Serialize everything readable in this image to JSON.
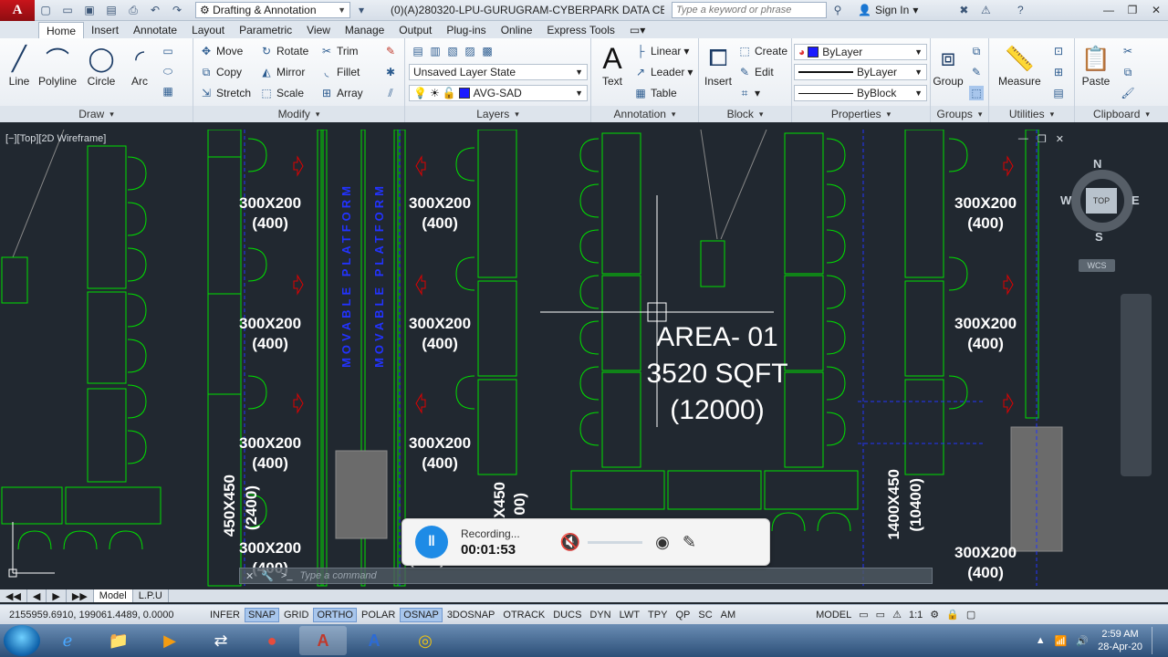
{
  "titlebar": {
    "workspace": "Drafting & Annotation",
    "document_title": "(0)(A)280320-LPU-GURUGRAM-CYBERPARK DATA CENTE...",
    "search_placeholder": "Type a keyword or phrase",
    "signin_label": "Sign In"
  },
  "tabs": [
    "Home",
    "Insert",
    "Annotate",
    "Layout",
    "Parametric",
    "View",
    "Manage",
    "Output",
    "Plug-ins",
    "Online",
    "Express Tools"
  ],
  "ribbon": {
    "draw": {
      "title": "Draw",
      "line": "Line",
      "polyline": "Polyline",
      "circle": "Circle",
      "arc": "Arc"
    },
    "modify": {
      "title": "Modify",
      "move": "Move",
      "rotate": "Rotate",
      "trim": "Trim",
      "copy": "Copy",
      "mirror": "Mirror",
      "fillet": "Fillet",
      "stretch": "Stretch",
      "scale": "Scale",
      "array": "Array"
    },
    "layers": {
      "title": "Layers",
      "layer_state": "Unsaved Layer State",
      "current_layer": "AVG-SAD"
    },
    "annotation": {
      "title": "Annotation",
      "text": "Text",
      "linear": "Linear",
      "leader": "Leader",
      "table": "Table"
    },
    "block": {
      "title": "Block",
      "insert": "Insert",
      "create": "Create",
      "edit": "Edit"
    },
    "properties": {
      "title": "Properties",
      "color": "ByLayer",
      "linetype": "ByLayer",
      "lineweight": "ByBlock"
    },
    "groups": {
      "title": "Groups",
      "group": "Group"
    },
    "utilities": {
      "title": "Utilities",
      "measure": "Measure"
    },
    "clipboard": {
      "title": "Clipboard",
      "paste": "Paste"
    }
  },
  "viewport": {
    "label": "[−][Top][2D Wireframe]",
    "area_name": "AREA- 01",
    "area_size": "3520 SQFT",
    "area_code": "(12000)",
    "duct_size": "300X200",
    "duct_flow": "(400)",
    "platform_text": "MOVABLE PLATFORM",
    "vertical_labels": [
      "450X450",
      "(2400)",
      "1400X450",
      "(10400)",
      "X450",
      "00)"
    ],
    "viewcube": {
      "n": "N",
      "s": "S",
      "e": "E",
      "w": "W",
      "top": "TOP",
      "wcs": "WCS"
    }
  },
  "command_line": {
    "placeholder": "Type a command"
  },
  "recorder": {
    "status": "Recording...",
    "time": "00:01:53"
  },
  "layout_tabs": [
    "Model",
    "L.P.U"
  ],
  "statusbar": {
    "coords": "2155959.6910, 199061.4489, 0.0000",
    "toggles": [
      {
        "label": "INFER",
        "on": false
      },
      {
        "label": "SNAP",
        "on": true
      },
      {
        "label": "GRID",
        "on": false
      },
      {
        "label": "ORTHO",
        "on": true
      },
      {
        "label": "POLAR",
        "on": false
      },
      {
        "label": "OSNAP",
        "on": true
      },
      {
        "label": "3DOSNAP",
        "on": false
      },
      {
        "label": "OTRACK",
        "on": false
      },
      {
        "label": "DUCS",
        "on": false
      },
      {
        "label": "DYN",
        "on": false
      },
      {
        "label": "LWT",
        "on": false
      },
      {
        "label": "TPY",
        "on": false
      },
      {
        "label": "QP",
        "on": false
      },
      {
        "label": "SC",
        "on": false
      },
      {
        "label": "AM",
        "on": false
      }
    ],
    "model": "MODEL",
    "scale": "1:1"
  },
  "taskbar": {
    "time": "2:59 AM",
    "date": "28-Apr-20"
  },
  "colors": {
    "cad_bg": "#212830",
    "cad_green": "#00e000",
    "cad_blue": "#2233ff",
    "cad_red": "#e00000",
    "accent": "#1e8be6"
  }
}
